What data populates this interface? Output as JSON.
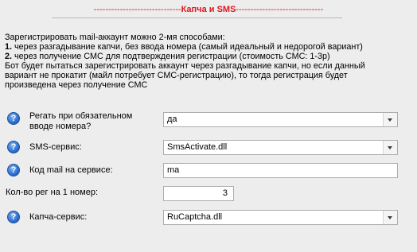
{
  "section": {
    "dashes_left": "------------------------------",
    "title": "Капча и SMS",
    "dashes_right": "------------------------------"
  },
  "description": {
    "line1": "Зарегистрировать mail-аккаунт можно 2-мя способами:",
    "item1_num": "1.",
    "item1_text": " через разгадывание капчи, без ввода номера (самый идеальный и недорогой вариант)",
    "item2_num": "2.",
    "item2_text": " через получение СМС для подтверждения регистрации (стоимость СМС: 1-3р)",
    "line4": "Бот будет пытаться зарегистрировать аккаунт через разгадывание капчи, но если данный",
    "line5": "вариант не прокатит (майл потребует СМС-регистрацию), то тогда регистрация будет",
    "line6": "произведена через получение СМС"
  },
  "fields": {
    "require_phone": {
      "label_line1": "Регать при обязательном",
      "label_line2": "вводе номера?",
      "value": "да"
    },
    "sms_service": {
      "label": "SMS-сервис:",
      "value": "SmsActivate.dll"
    },
    "mail_code": {
      "label": "Код mail на сервисе:",
      "value": "ma"
    },
    "regs_per_number": {
      "label": "Кол-во рег на 1 номер:",
      "value": "3"
    },
    "captcha_service": {
      "label": "Капча-сервис:",
      "value": "RuCaptcha.dll"
    }
  },
  "help_icon_glyph": "?"
}
